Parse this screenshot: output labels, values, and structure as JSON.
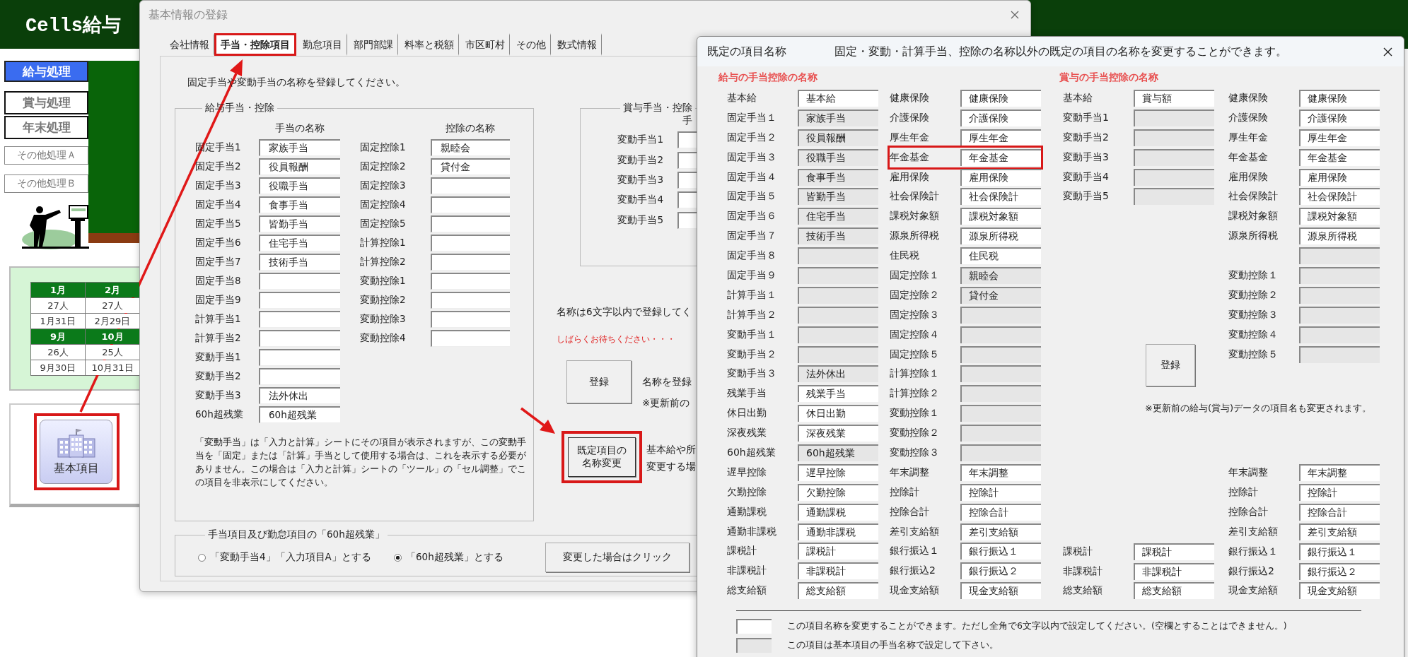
{
  "app": {
    "title": "Cells給与",
    "menu": [
      {
        "label": "給与処理",
        "kind": "main",
        "selected": true
      },
      {
        "label": "賞与処理",
        "kind": "main",
        "selected": false
      },
      {
        "label": "年末処理",
        "kind": "main",
        "selected": false
      },
      {
        "label": "その他処理Ａ",
        "kind": "sub",
        "selected": false
      },
      {
        "label": "その他処理Ｂ",
        "kind": "sub",
        "selected": false
      }
    ],
    "calendar": [
      {
        "kind": "month",
        "cells": [
          "1月",
          "2月"
        ]
      },
      {
        "kind": "count",
        "cells": [
          "27人",
          "27人"
        ]
      },
      {
        "kind": "date",
        "cells": [
          "1月31日",
          "2月29日"
        ]
      },
      {
        "kind": "month",
        "cells": [
          "9月",
          "10月"
        ]
      },
      {
        "kind": "count",
        "cells": [
          "26人",
          "25人"
        ]
      },
      {
        "kind": "date",
        "cells": [
          "9月30日",
          "10月31日"
        ]
      }
    ],
    "basic_button": {
      "label": "基本項目",
      "highlighted": true
    }
  },
  "basic_info_dialog": {
    "title": "基本情報の登録",
    "tabs": [
      {
        "label": "会社情報",
        "selected": false,
        "highlighted": false
      },
      {
        "label": "手当・控除項目",
        "selected": true,
        "highlighted": true
      },
      {
        "label": "勤怠項目",
        "selected": false,
        "highlighted": false
      },
      {
        "label": "部門部課",
        "selected": false,
        "highlighted": false
      },
      {
        "label": "料率と税額",
        "selected": false,
        "highlighted": false
      },
      {
        "label": "市区町村",
        "selected": false,
        "highlighted": false
      },
      {
        "label": "その他",
        "selected": false,
        "highlighted": false
      },
      {
        "label": "数式情報",
        "selected": false,
        "highlighted": false
      }
    ],
    "instruction": "固定手当や変動手当の名称を登録してください。",
    "salary_group": {
      "title": "給与手当・控除",
      "allowance_header": "手当の名称",
      "deduction_header": "控除の名称",
      "allowances": [
        {
          "label": "固定手当1",
          "value": "家族手当"
        },
        {
          "label": "固定手当2",
          "value": "役員報酬"
        },
        {
          "label": "固定手当3",
          "value": "役職手当"
        },
        {
          "label": "固定手当4",
          "value": "食事手当"
        },
        {
          "label": "固定手当5",
          "value": "皆勤手当"
        },
        {
          "label": "固定手当6",
          "value": "住宅手当"
        },
        {
          "label": "固定手当7",
          "value": "技術手当"
        },
        {
          "label": "固定手当8"
        },
        {
          "label": "固定手当9"
        },
        {
          "label": "計算手当1"
        },
        {
          "label": "計算手当2"
        },
        {
          "label": "変動手当1"
        },
        {
          "label": "変動手当2"
        },
        {
          "label": "変動手当3",
          "value": "法外休出"
        },
        {
          "label": "60h超残業",
          "value": "60h超残業"
        }
      ],
      "deductions": [
        {
          "label": "固定控除1",
          "value": "親睦会"
        },
        {
          "label": "固定控除2",
          "value": "貸付金"
        },
        {
          "label": "固定控除3"
        },
        {
          "label": "固定控除4"
        },
        {
          "label": "固定控除5"
        },
        {
          "label": "計算控除1"
        },
        {
          "label": "計算控除2"
        },
        {
          "label": "変動控除1"
        },
        {
          "label": "変動控除2"
        },
        {
          "label": "変動控除3"
        },
        {
          "label": "変動控除4"
        }
      ],
      "note": "「変動手当」は「入力と計算」シートにその項目が表示されますが、この変動手当を「固定」または「計算」手当として使用する場合は、これを表示する必要がありません。この場合は「入力と計算」シートの「ツール」の「セル調整」でこの項目を非表示にしてください。"
    },
    "bonus_group": {
      "title": "賞与手当・控除",
      "header": "手",
      "items": [
        {
          "label": "変動手当1"
        },
        {
          "label": "変動手当2"
        },
        {
          "label": "変動手当3"
        },
        {
          "label": "変動手当4"
        },
        {
          "label": "変動手当5"
        }
      ]
    },
    "length_note": "名称は6文字以内で登録してく",
    "wait_message": "しばらくお待ちください・・・",
    "register_button": "登録",
    "register_note": [
      "名称を登録",
      "※更新前の"
    ],
    "rename_button": {
      "lines": [
        "既定項目の",
        "名称変更"
      ],
      "highlighted": true
    },
    "rename_note": [
      "基本給や所",
      "変更する場"
    ],
    "overtime_group": {
      "title": "手当項目及び勤怠項目の「60h超残業」",
      "options": [
        {
          "label": "「変動手当4」「入力項目A」とする",
          "selected": false
        },
        {
          "label": "「60h超残業」とする",
          "selected": true
        }
      ],
      "apply_button": "変更した場合はクリック"
    }
  },
  "default_names_dialog": {
    "title": "既定の項目名称",
    "description": "固定・変動・計算手当、控除の名称以外の既定の項目の名称を変更することができます。",
    "salary": {
      "title": "給与の手当控除の名称",
      "allowances": [
        {
          "label": "基本給",
          "value": "基本給",
          "editable": true
        },
        {
          "label": "固定手当１",
          "value": "家族手当",
          "editable": false
        },
        {
          "label": "固定手当２",
          "value": "役員報酬",
          "editable": false
        },
        {
          "label": "固定手当３",
          "value": "役職手当",
          "editable": false
        },
        {
          "label": "固定手当４",
          "value": "食事手当",
          "editable": false
        },
        {
          "label": "固定手当５",
          "value": "皆勤手当",
          "editable": false
        },
        {
          "label": "固定手当６",
          "value": "住宅手当",
          "editable": false
        },
        {
          "label": "固定手当７",
          "value": "技術手当",
          "editable": false
        },
        {
          "label": "固定手当８",
          "editable": false
        },
        {
          "label": "固定手当９",
          "editable": false
        },
        {
          "label": "計算手当１",
          "editable": false
        },
        {
          "label": "計算手当２",
          "editable": false
        },
        {
          "label": "変動手当１",
          "editable": false
        },
        {
          "label": "変動手当２",
          "editable": false
        },
        {
          "label": "変動手当３",
          "value": "法外休出",
          "editable": false
        },
        {
          "label": "残業手当",
          "value": "残業手当",
          "editable": true
        },
        {
          "label": "休日出勤",
          "value": "休日出勤",
          "editable": true
        },
        {
          "label": "深夜残業",
          "value": "深夜残業",
          "editable": true
        },
        {
          "label": "60h超残業",
          "value": "60h超残業",
          "editable": false
        },
        {
          "label": "遅早控除",
          "value": "遅早控除",
          "editable": true
        },
        {
          "label": "欠勤控除",
          "value": "欠勤控除",
          "editable": true
        },
        {
          "label": "通勤課税",
          "value": "通勤課税",
          "editable": true
        },
        {
          "label": "通勤非課税",
          "value": "通勤非課税",
          "editable": true
        },
        {
          "label": "課税計",
          "value": "課税計",
          "editable": true
        },
        {
          "label": "非課税計",
          "value": "非課税計",
          "editable": true
        },
        {
          "label": "総支給額",
          "value": "総支給額",
          "editable": true
        }
      ],
      "deductions": [
        {
          "label": "健康保険",
          "value": "健康保険",
          "editable": true,
          "highlighted": false
        },
        {
          "label": "介護保険",
          "value": "介護保険",
          "editable": true,
          "highlighted": false
        },
        {
          "label": "厚生年金",
          "value": "厚生年金",
          "editable": true,
          "highlighted": false
        },
        {
          "label": "年金基金",
          "value": "年金基金",
          "editable": true,
          "highlighted": true
        },
        {
          "label": "雇用保険",
          "value": "雇用保険",
          "editable": true,
          "highlighted": false
        },
        {
          "label": "社会保険計",
          "value": "社会保険計",
          "editable": true,
          "highlighted": false
        },
        {
          "label": "課税対象額",
          "value": "課税対象額",
          "editable": true,
          "highlighted": false
        },
        {
          "label": "源泉所得税",
          "value": "源泉所得税",
          "editable": true,
          "highlighted": false
        },
        {
          "label": "住民税",
          "value": "住民税",
          "editable": true,
          "highlighted": false
        },
        {
          "label": "固定控除１",
          "value": "親睦会",
          "editable": false,
          "highlighted": false
        },
        {
          "label": "固定控除２",
          "value": "貸付金",
          "editable": false,
          "highlighted": false
        },
        {
          "label": "固定控除３",
          "editable": false,
          "highlighted": false
        },
        {
          "label": "固定控除４",
          "editable": false,
          "highlighted": false
        },
        {
          "label": "固定控除５",
          "editable": false,
          "highlighted": false
        },
        {
          "label": "計算控除１",
          "editable": false,
          "highlighted": false
        },
        {
          "label": "計算控除２",
          "editable": false,
          "highlighted": false
        },
        {
          "label": "変動控除１",
          "editable": false,
          "highlighted": false
        },
        {
          "label": "変動控除２",
          "editable": false,
          "highlighted": false
        },
        {
          "label": "変動控除３",
          "editable": false,
          "highlighted": false
        },
        {
          "label": "年末調整",
          "value": "年末調整",
          "editable": true,
          "highlighted": false
        },
        {
          "label": "控除計",
          "value": "控除計",
          "editable": true,
          "highlighted": false
        },
        {
          "label": "控除合計",
          "value": "控除合計",
          "editable": true,
          "highlighted": false
        },
        {
          "label": "差引支給額",
          "value": "差引支給額",
          "editable": true,
          "highlighted": false
        },
        {
          "label": "銀行振込１",
          "value": "銀行振込１",
          "editable": true,
          "highlighted": false
        },
        {
          "label": "銀行振込2",
          "value": "銀行振込２",
          "editable": true,
          "highlighted": false
        },
        {
          "label": "現金支給額",
          "value": "現金支給額",
          "editable": true,
          "highlighted": false
        }
      ]
    },
    "bonus": {
      "title": "賞与の手当控除の名称",
      "allowances": {
        "top": [
          {
            "label": "基本給",
            "value": "賞与額",
            "editable": true
          },
          {
            "label": "変動手当1",
            "editable": false
          },
          {
            "label": "変動手当2",
            "editable": false
          },
          {
            "label": "変動手当3",
            "editable": false
          },
          {
            "label": "変動手当4",
            "editable": false
          },
          {
            "label": "変動手当5",
            "editable": false
          }
        ],
        "bottom": [
          {
            "label": "課税計",
            "value": "課税計",
            "editable": true
          },
          {
            "label": "非課税計",
            "value": "非課税計",
            "editable": true
          },
          {
            "label": "総支給額",
            "value": "総支給額",
            "editable": true
          }
        ]
      },
      "deductions": {
        "top": [
          {
            "label": "健康保険",
            "value": "健康保険",
            "editable": true
          },
          {
            "label": "介護保険",
            "value": "介護保険",
            "editable": true
          },
          {
            "label": "厚生年金",
            "value": "厚生年金",
            "editable": true
          },
          {
            "label": "年金基金",
            "value": "年金基金",
            "editable": true
          },
          {
            "label": "雇用保険",
            "value": "雇用保険",
            "editable": true
          },
          {
            "label": "社会保険計",
            "value": "社会保険計",
            "editable": true
          },
          {
            "label": "課税対象額",
            "value": "課税対象額",
            "editable": true
          },
          {
            "label": "源泉所得税",
            "value": "源泉所得税",
            "editable": true
          },
          {
            "editable": false
          },
          {
            "label": "変動控除１",
            "editable": false
          },
          {
            "label": "変動控除２",
            "editable": false
          },
          {
            "label": "変動控除３",
            "editable": false
          },
          {
            "label": "変動控除４",
            "editable": false
          },
          {
            "label": "変動控除５",
            "editable": false
          }
        ],
        "bottom": [
          {
            "label": "年末調整",
            "value": "年末調整",
            "editable": true
          },
          {
            "label": "控除計",
            "value": "控除計",
            "editable": true
          },
          {
            "label": "控除合計",
            "value": "控除合計",
            "editable": true
          },
          {
            "label": "差引支給額",
            "value": "差引支給額",
            "editable": true
          },
          {
            "label": "銀行振込１",
            "value": "銀行振込１",
            "editable": true
          },
          {
            "label": "銀行振込2",
            "value": "銀行振込２",
            "editable": true
          },
          {
            "label": "現金支給額",
            "value": "現金支給額",
            "editable": true
          }
        ]
      },
      "register_button": "登録",
      "note": "※更新前の給与(賞与)データの項目名も変更されます。"
    },
    "legend": [
      {
        "editable": true,
        "text": "この項目名称を変更することができます。ただし全角で6文字以内で設定してください。(空欄とすることはできません。)"
      },
      {
        "editable": false,
        "text": "この項目は基本項目の手当名称で設定して下さい。"
      }
    ]
  }
}
